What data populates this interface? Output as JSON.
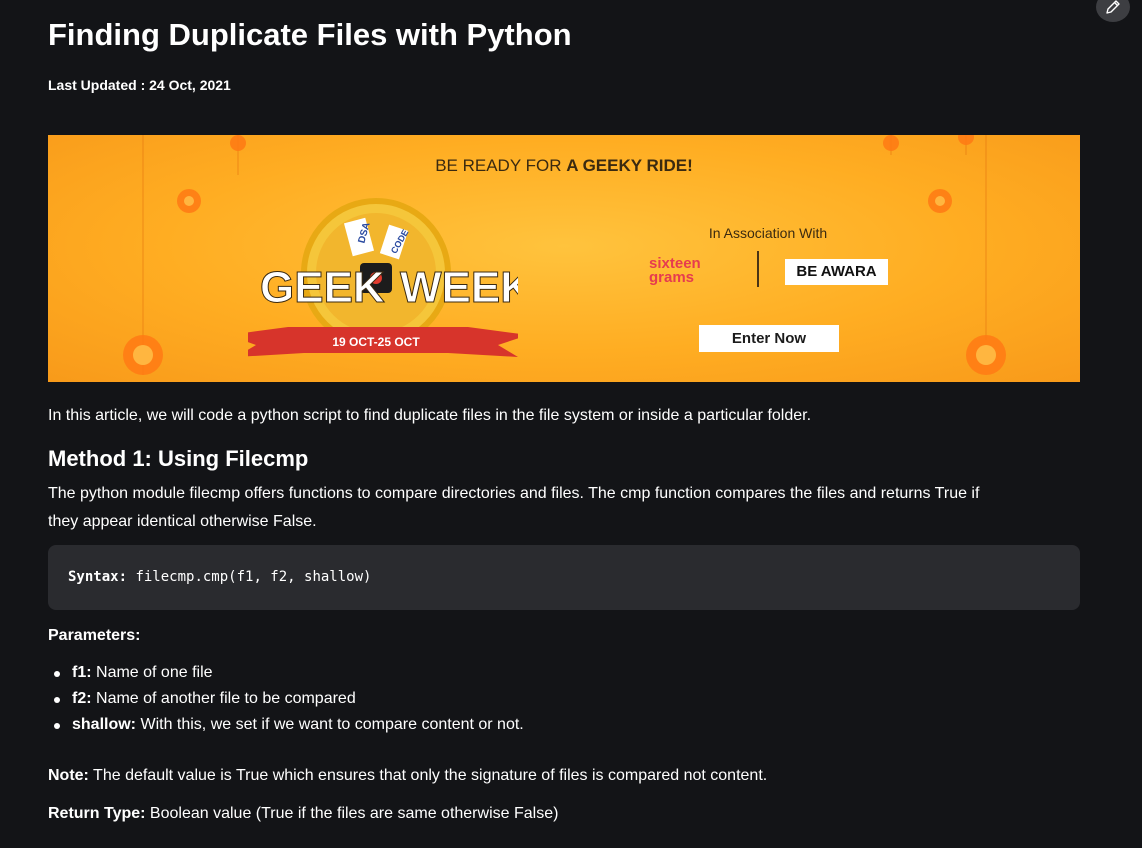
{
  "article": {
    "title": "Finding Duplicate Files with Python",
    "last_updated": "Last Updated : 24 Oct, 2021"
  },
  "banner": {
    "headline_prefix": "BE READY FOR ",
    "headline_bold": "A GEEKY RIDE!",
    "association_text": "In Association With",
    "sponsor_1_line_1": "sixteen",
    "sponsor_1_line_2": "grams",
    "sponsor_2": "BE AWARA",
    "cta_label": "Enter Now",
    "logo_word_left": "GEEK",
    "logo_word_right": "WEEK",
    "logo_dates": "19 OCT-25 OCT",
    "ticket_1": "DSA",
    "ticket_2": "CODE",
    "colors": {
      "background": "#ffad22",
      "ribbon": "#d7342b",
      "medal": "#f5c63a"
    }
  },
  "intro": "In this article, we will code a python script to find duplicate files in the file system or inside a particular folder.",
  "method1": {
    "heading": "Method 1: Using Filecmp",
    "description_line_1": "The python module filecmp offers functions to compare directories and files. The cmp function compares the files and returns True if",
    "description_line_2": "they appear identical otherwise False.",
    "syntax_label": "Syntax:",
    "syntax_code": " filecmp.cmp(f1, f2, shallow)",
    "parameters_label": "Parameters:",
    "parameters": [
      {
        "name": "f1:",
        "desc": " Name of one file"
      },
      {
        "name": "f2:",
        "desc": " Name of another file to be compared"
      },
      {
        "name": "shallow:",
        "desc": " With this, we set if we want to compare content or not."
      }
    ],
    "note_label": "Note:",
    "note_text": " The default value is True which ensures that only the signature of files is compared not content.",
    "return_label": "Return Type:",
    "return_text": " Boolean value (True if the files are same otherwise False)"
  },
  "icons": {
    "edit": "pencil-icon"
  },
  "theme": {
    "background": "#131417",
    "code_background": "#2a2b2f",
    "text": "#ffffff"
  }
}
